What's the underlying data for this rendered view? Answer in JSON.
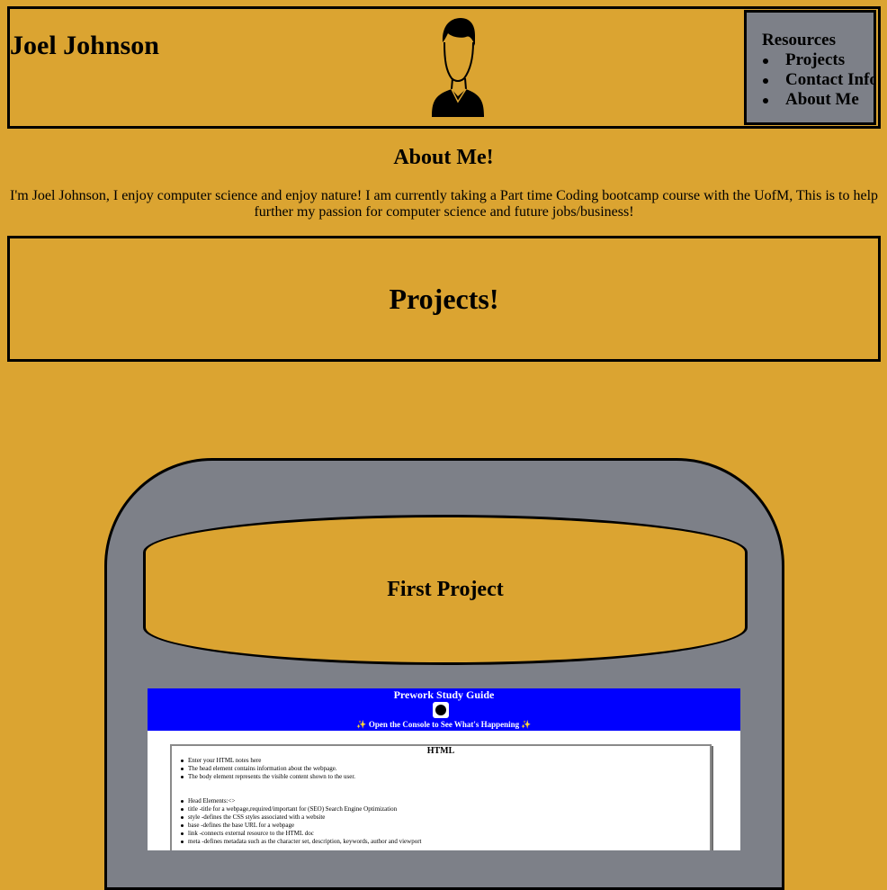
{
  "header": {
    "site_name": "Joel Johnson",
    "avatar_icon": "person-silhouette-icon"
  },
  "nav": {
    "title": "Resources",
    "items": [
      {
        "label": "Projects"
      },
      {
        "label": "Contact Info"
      },
      {
        "label": "About Me"
      }
    ]
  },
  "about": {
    "heading": "About Me!",
    "text": "I'm Joel Johnson, I enjoy computer science and enjoy nature! I am currently taking a Part time Coding bootcamp course with the UofM, This is to help further my passion for computer science and future jobs/business!"
  },
  "projects": {
    "heading": "Projects!",
    "first_project": {
      "title": "First Project",
      "preview": {
        "title": "Prework Study Guide",
        "console_note": "✨ Open the Console to See What's Happening ✨",
        "panel_title": "HTML",
        "lines": [
          "Enter your HTML notes here",
          "The head element contains information about the webpage.",
          "The body element represents the visible content shown to the user.",
          "",
          "Head Elements:<>",
          "title -title for a webpage,required/important for (SEO) Search Engine Optimization",
          "style -defines the CSS styles associated with a website",
          "base -defines the base URL for a webpage",
          "link -connects external resource to the HTML doc",
          "meta -defines metadata such as the character set, description, keywords, author and viewport"
        ]
      }
    }
  },
  "colors": {
    "background": "#dba431",
    "nav_background": "#7d8088",
    "card_background": "#7d8088",
    "preview_header": "#0000ff"
  }
}
